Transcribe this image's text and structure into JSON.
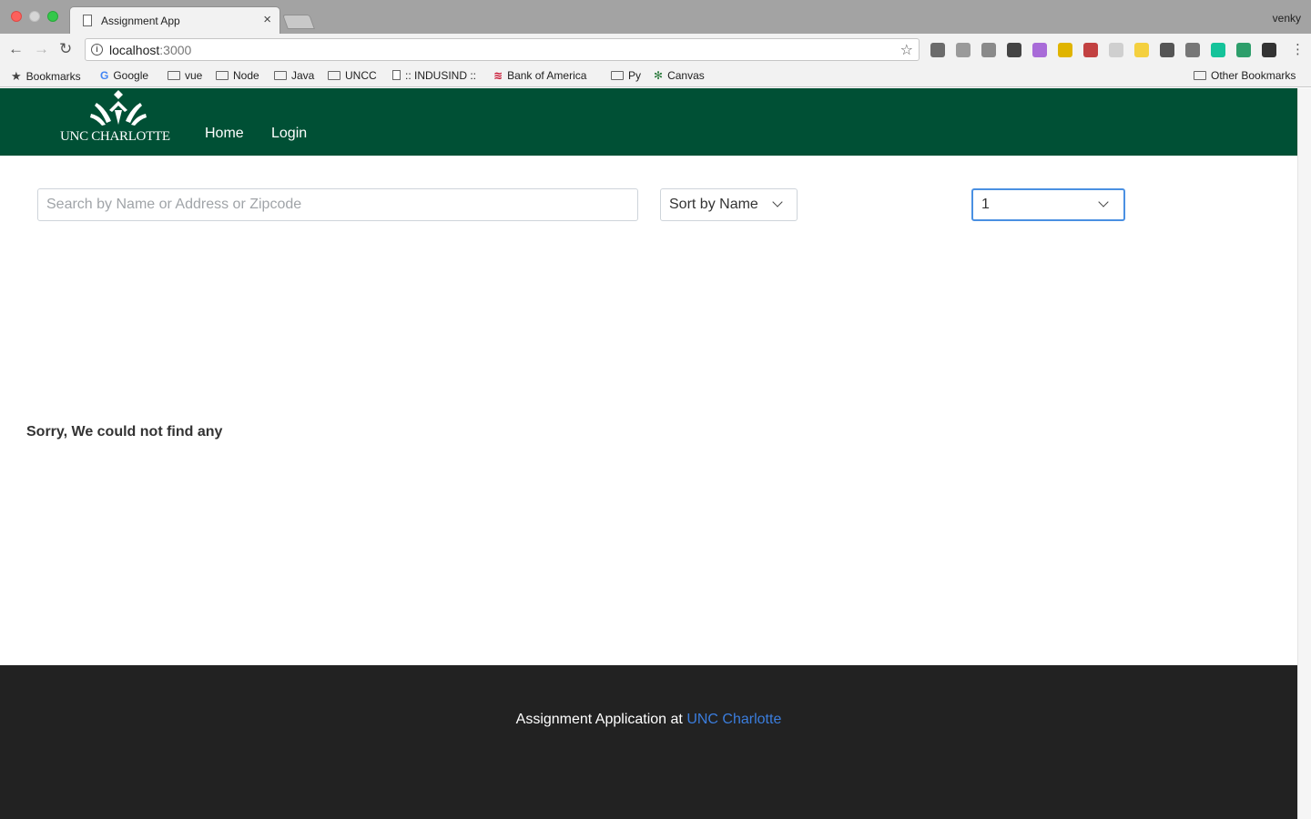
{
  "browser": {
    "tab_title": "Assignment App",
    "tab_close": "×",
    "profile_name": "venky",
    "url_host": "localhost",
    "url_port": ":3000",
    "nav_back": "←",
    "nav_forward": "→",
    "nav_reload": "↻",
    "star": "☆",
    "bookmarks": {
      "bookmarks_label": "Bookmarks",
      "google": "Google",
      "vue": "vue",
      "node": "Node",
      "java": "Java",
      "uncc": "UNCC",
      "indusind": ":: INDUSIND ::",
      "boa": "Bank of America",
      "py": "Py",
      "canvas": "Canvas",
      "other": "Other Bookmarks"
    },
    "extension_colors": [
      "#6b6b6b",
      "#9a9a9a",
      "#8a8a8a",
      "#444444",
      "#a86bd8",
      "#e0b400",
      "#c24141",
      "#cfcfcf",
      "#f4d03f",
      "#555555",
      "#777777",
      "#15c39a",
      "#2e9e6b",
      "#333333"
    ]
  },
  "app": {
    "logo_text": "UNC CHARLOTTE",
    "nav": {
      "home": "Home",
      "login": "Login"
    },
    "search": {
      "placeholder": "Search by Name or Address or Zipcode",
      "value": ""
    },
    "sort_select": {
      "selected": "Sort by Name"
    },
    "page_select": {
      "selected": "1"
    },
    "empty_message": "Sorry, We could not find any",
    "footer": {
      "text": "Assignment Application at",
      "link": "UNC Charlotte"
    },
    "colors": {
      "brand_green": "#005035",
      "footer_bg": "#222222",
      "link_blue": "#3b7ddd",
      "focus_blue": "#4a90e2"
    }
  }
}
